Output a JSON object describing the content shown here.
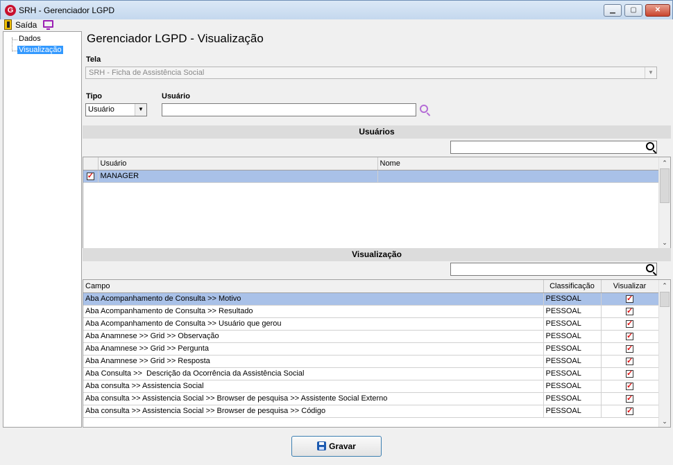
{
  "window": {
    "title": "SRH - Gerenciador LGPD",
    "icon": "app-logo-icon",
    "app_icon_letter": "G"
  },
  "window_controls": {
    "minimize": "▁",
    "maximize": "▢",
    "close": "✕"
  },
  "menu": {
    "exit_label": "Saída"
  },
  "tree": {
    "items": [
      {
        "label": "Dados"
      },
      {
        "label": "Visualização",
        "selected": true
      }
    ]
  },
  "page_title": "Gerenciador LGPD - Visualização",
  "form": {
    "tela_label": "Tela",
    "tela_value": "SRH - Ficha de Assistência Social",
    "tipo_label": "Tipo",
    "tipo_value": "Usuário",
    "usuario_label": "Usuário",
    "usuario_value": ""
  },
  "users_section": {
    "title": "Usuários",
    "search_value": "",
    "columns": [
      "Usuário",
      "Nome"
    ],
    "rows": [
      {
        "checked": true,
        "usuario": "MANAGER",
        "nome": ""
      }
    ]
  },
  "view_section": {
    "title": "Visualização",
    "search_value": "",
    "columns": [
      "Campo",
      "Classificação",
      "Visualizar"
    ],
    "rows": [
      {
        "campo": "Aba Acompanhamento de Consulta >> Motivo",
        "classificacao": "PESSOAL",
        "visualizar": true
      },
      {
        "campo": "Aba Acompanhamento de Consulta >> Resultado",
        "classificacao": "PESSOAL",
        "visualizar": true
      },
      {
        "campo": "Aba Acompanhamento de Consulta >> Usuário que gerou",
        "classificacao": "PESSOAL",
        "visualizar": true
      },
      {
        "campo": "Aba Anamnese >> Grid >> Observação",
        "classificacao": "PESSOAL",
        "visualizar": true
      },
      {
        "campo": "Aba Anamnese >> Grid >> Pergunta",
        "classificacao": "PESSOAL",
        "visualizar": true
      },
      {
        "campo": "Aba Anamnese >> Grid >> Resposta",
        "classificacao": "PESSOAL",
        "visualizar": true
      },
      {
        "campo": "Aba Consulta >>  Descrição da Ocorrência da Assistência Social",
        "classificacao": "PESSOAL",
        "visualizar": true
      },
      {
        "campo": "Aba consulta >> Assistencia Social",
        "classificacao": "PESSOAL",
        "visualizar": true
      },
      {
        "campo": "Aba consulta >> Assistencia Social >> Browser de pesquisa >> Assistente Social Externo",
        "classificacao": "PESSOAL",
        "visualizar": true
      },
      {
        "campo": "Aba consulta >> Assistencia Social >> Browser de pesquisa >> Código",
        "classificacao": "PESSOAL",
        "visualizar": true
      }
    ]
  },
  "save_button": {
    "label": "Gravar"
  },
  "colors": {
    "selection": "#a9c1e8",
    "tree_selection": "#3399ff",
    "check": "#dd1111",
    "header_bg": "#dcdcdc"
  }
}
